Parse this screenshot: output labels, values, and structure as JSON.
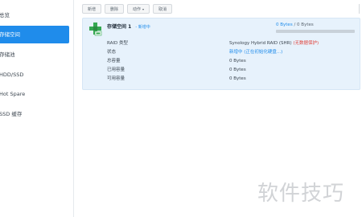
{
  "sidebar": {
    "items": [
      {
        "label": "总览",
        "active": false
      },
      {
        "label": "存储空间",
        "active": true
      },
      {
        "label": "存储池",
        "active": false
      },
      {
        "label": "HDD/SSD",
        "active": false
      },
      {
        "label": "Hot Spare",
        "active": false
      },
      {
        "label": "SSD 缓存",
        "active": false
      }
    ]
  },
  "toolbar": {
    "new_label": "新增",
    "delete_label": "删除",
    "action_label": "动作",
    "cancel_label": "取消"
  },
  "volume": {
    "name": "存储空间 1",
    "status_tag": "- 新增中",
    "usage_used": "0 Bytes",
    "usage_sep": "/",
    "usage_total": "0 Bytes",
    "usage_fraction": 0,
    "rows": [
      {
        "label": "RAID 类型",
        "value": "Synology Hybrid RAID (SHR)",
        "value_red": "(无数据保护)"
      },
      {
        "label": "状态",
        "value_blue": "新增中 (正在初始化硬盘...)"
      },
      {
        "label": "总容量",
        "value": "0 Bytes"
      },
      {
        "label": "已用容量",
        "value": "0 Bytes"
      },
      {
        "label": "可用容量",
        "value": "0 Bytes"
      }
    ]
  },
  "watermark": "软件技巧",
  "colors": {
    "accent": "#1f8ceb",
    "panel_bg": "#e7f2fc",
    "warning": "#e0433b"
  }
}
